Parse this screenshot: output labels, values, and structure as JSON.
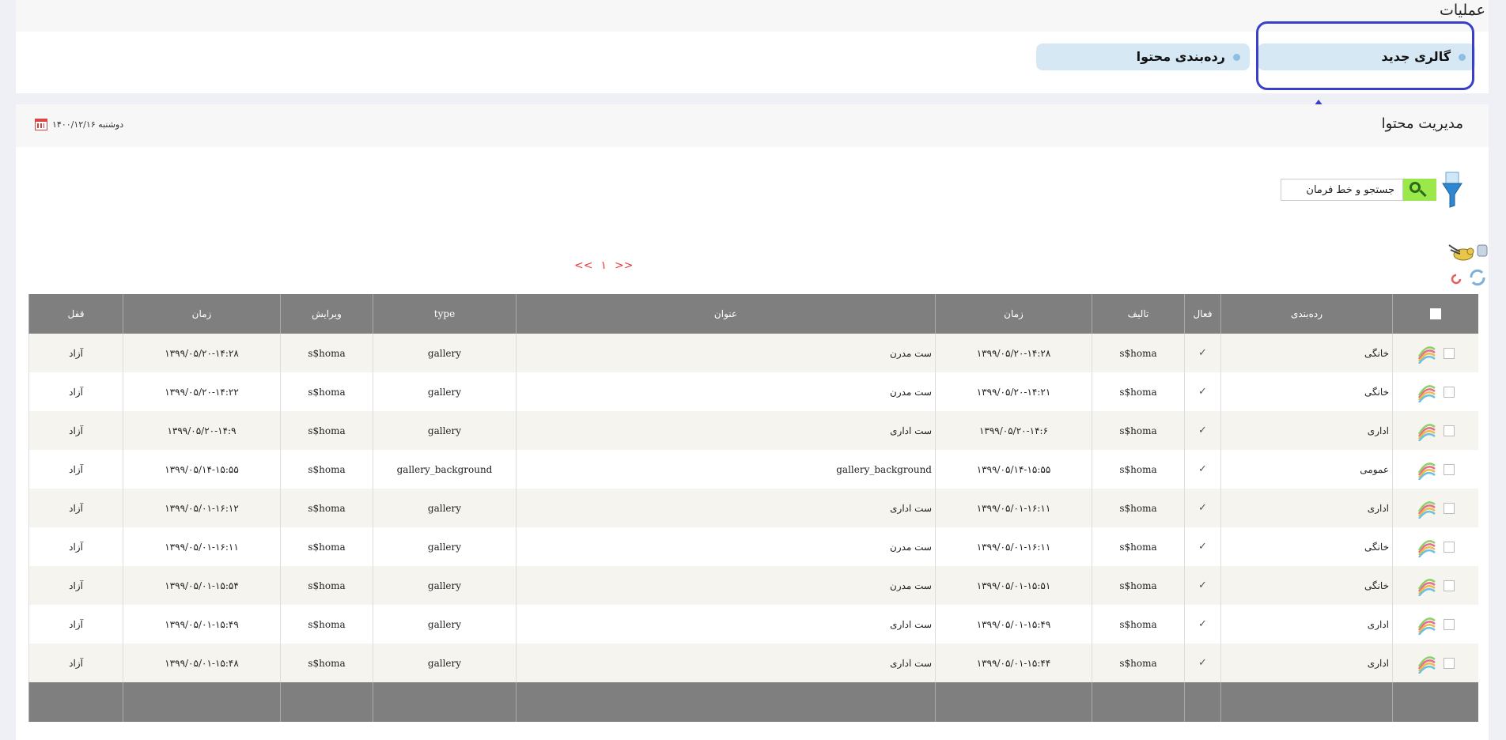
{
  "operations": {
    "title": "عملیات"
  },
  "tabs": [
    {
      "label": "گالری جدید"
    },
    {
      "label": "رده‌بندی محتوا"
    }
  ],
  "page": {
    "title": "مدیریت محتوا",
    "date": "دوشنبه ۱۴۰۰/۱۲/۱۶"
  },
  "search": {
    "value": "جستجو و خط فرمان"
  },
  "pager": {
    "prev": "<<",
    "current": "۱",
    "next": ">>"
  },
  "table": {
    "headers": {
      "category": "رده‌بندی",
      "active": "فعال",
      "author": "تالیف",
      "time": "زمان",
      "title": "عنوان",
      "type": "type",
      "editor": "ویرایش",
      "edit_time": "زمان",
      "lock": "قفل"
    },
    "rows": [
      {
        "category": "خانگی",
        "active": "✓",
        "author": "s$homa",
        "time": "۱۳۹۹/۰۵/۲۰-۱۴:۲۸",
        "title": "ست مدرن",
        "type": "gallery",
        "editor": "s$homa",
        "edit_time": "۱۳۹۹/۰۵/۲۰-۱۴:۲۸",
        "lock": "آزاد"
      },
      {
        "category": "خانگی",
        "active": "✓",
        "author": "s$homa",
        "time": "۱۳۹۹/۰۵/۲۰-۱۴:۲۱",
        "title": "ست مدرن",
        "type": "gallery",
        "editor": "s$homa",
        "edit_time": "۱۳۹۹/۰۵/۲۰-۱۴:۲۲",
        "lock": "آزاد"
      },
      {
        "category": "اداری",
        "active": "✓",
        "author": "s$homa",
        "time": "۱۳۹۹/۰۵/۲۰-۱۴:۶",
        "title": "ست اداری",
        "type": "gallery",
        "editor": "s$homa",
        "edit_time": "۱۳۹۹/۰۵/۲۰-۱۴:۹",
        "lock": "آزاد"
      },
      {
        "category": "عمومی",
        "active": "✓",
        "author": "s$homa",
        "time": "۱۳۹۹/۰۵/۱۴-۱۵:۵۵",
        "title": "gallery_background",
        "type": "gallery_background",
        "editor": "s$homa",
        "edit_time": "۱۳۹۹/۰۵/۱۴-۱۵:۵۵",
        "lock": "آزاد"
      },
      {
        "category": "اداری",
        "active": "✓",
        "author": "s$homa",
        "time": "۱۳۹۹/۰۵/۰۱-۱۶:۱۱",
        "title": "ست اداری",
        "type": "gallery",
        "editor": "s$homa",
        "edit_time": "۱۳۹۹/۰۵/۰۱-۱۶:۱۲",
        "lock": "آزاد"
      },
      {
        "category": "خانگی",
        "active": "✓",
        "author": "s$homa",
        "time": "۱۳۹۹/۰۵/۰۱-۱۶:۱۱",
        "title": "ست مدرن",
        "type": "gallery",
        "editor": "s$homa",
        "edit_time": "۱۳۹۹/۰۵/۰۱-۱۶:۱۱",
        "lock": "آزاد"
      },
      {
        "category": "خانگی",
        "active": "✓",
        "author": "s$homa",
        "time": "۱۳۹۹/۰۵/۰۱-۱۵:۵۱",
        "title": "ست مدرن",
        "type": "gallery",
        "editor": "s$homa",
        "edit_time": "۱۳۹۹/۰۵/۰۱-۱۵:۵۴",
        "lock": "آزاد"
      },
      {
        "category": "اداری",
        "active": "✓",
        "author": "s$homa",
        "time": "۱۳۹۹/۰۵/۰۱-۱۵:۴۹",
        "title": "ست اداری",
        "type": "gallery",
        "editor": "s$homa",
        "edit_time": "۱۳۹۹/۰۵/۰۱-۱۵:۴۹",
        "lock": "آزاد"
      },
      {
        "category": "اداری",
        "active": "✓",
        "author": "s$homa",
        "time": "۱۳۹۹/۰۵/۰۱-۱۵:۴۴",
        "title": "ست اداری",
        "type": "gallery",
        "editor": "s$homa",
        "edit_time": "۱۳۹۹/۰۵/۰۱-۱۵:۴۸",
        "lock": "آزاد"
      }
    ]
  },
  "colors": {
    "highlight": "#3a3fc7",
    "tab_bg": "#d6e8f4",
    "header_bg": "#7f7f7f",
    "search_btn": "#9be84a",
    "pager": "#e33333"
  }
}
